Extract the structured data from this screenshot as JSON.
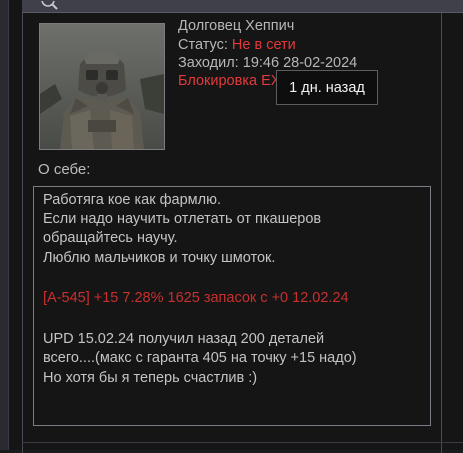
{
  "profile": {
    "name": "Долговец Хеппич",
    "status_label": "Статус:",
    "status_value": "Не в сети",
    "visited_label": "Заходил:",
    "visited_value": "19:46 28-02-2024",
    "blocked_text": "Блокировка ЕХ"
  },
  "tooltip": {
    "text": "1 дн. назад"
  },
  "about": {
    "label": "О себе:",
    "lines": [
      "Работяга кое как фармлю.",
      "Если надо научить отлетать от пкашеров",
      "обращайтесь научу.",
      "Люблю мальчиков и точку шмоток.",
      "[A-545] +15 7.28% 1625 запасок с +0 12.02.24",
      "UPD 15.02.24 получил назад 200 деталей",
      "всего....(макс с гаранта 405 на точку +15 надо)",
      "Но хотя бы я теперь счастлив :)"
    ]
  },
  "colors": {
    "status_offline": "#e23a3a",
    "highlight_line": "#c8302f",
    "text": "#c4c4c4",
    "background": "#151516"
  },
  "icons": {
    "header": "search-icon",
    "avatar": "soldier-avatar-image"
  }
}
